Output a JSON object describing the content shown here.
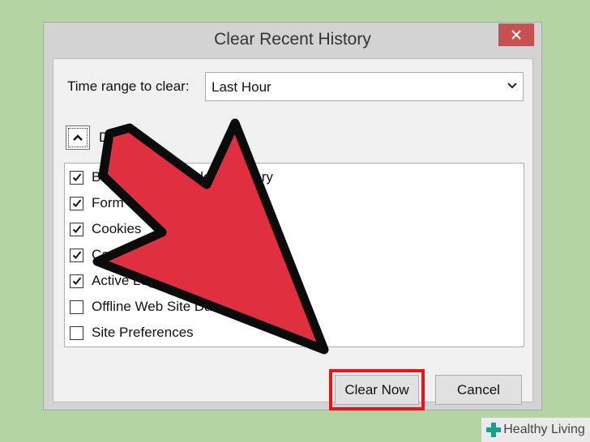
{
  "window": {
    "title": "Clear Recent History"
  },
  "time_range": {
    "label": "Time range to clear:",
    "selected": "Last Hour"
  },
  "details": {
    "label": "D"
  },
  "items": [
    {
      "label": "Browsing & Download History",
      "checked": true
    },
    {
      "label": "Form & Search History",
      "checked": true
    },
    {
      "label": "Cookies",
      "checked": true
    },
    {
      "label": "Cache",
      "checked": true
    },
    {
      "label": "Active Logins",
      "checked": true
    },
    {
      "label": "Offline Web Site Data",
      "checked": false
    },
    {
      "label": "Site Preferences",
      "checked": false
    }
  ],
  "buttons": {
    "clear_now": "Clear Now",
    "cancel": "Cancel"
  },
  "brand": {
    "name": "Healthy Living",
    "color": "#1a9e8c"
  },
  "annotation": {
    "arrow_color": "#e03040",
    "highlight_color": "#e3141c"
  }
}
